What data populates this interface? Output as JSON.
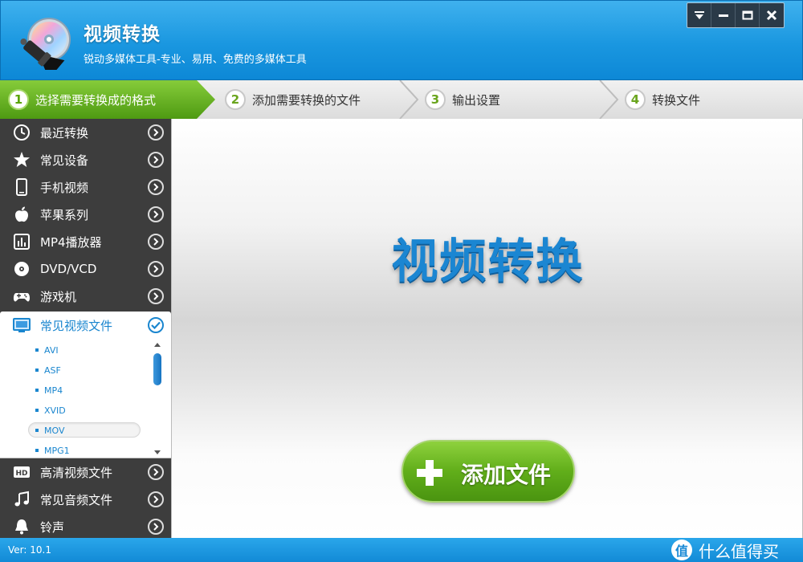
{
  "app": {
    "title": "视频转换",
    "subtitle": "锐动多媒体工具-专业、易用、免费的多媒体工具"
  },
  "window_controls": [
    "dropdown-icon",
    "minimize-icon",
    "maximize-icon",
    "close-icon"
  ],
  "steps": [
    {
      "num": "1",
      "label": "选择需要转换成的格式",
      "active": true
    },
    {
      "num": "2",
      "label": "添加需要转换的文件",
      "active": false
    },
    {
      "num": "3",
      "label": "输出设置",
      "active": false
    },
    {
      "num": "4",
      "label": "转换文件",
      "active": false
    }
  ],
  "sidebar": {
    "items": [
      {
        "label": "最近转换",
        "icon": "clock-icon"
      },
      {
        "label": "常见设备",
        "icon": "star-icon"
      },
      {
        "label": "手机视频",
        "icon": "phone-icon"
      },
      {
        "label": "苹果系列",
        "icon": "apple-icon"
      },
      {
        "label": "MP4播放器",
        "icon": "mp4-player-icon"
      },
      {
        "label": "DVD/VCD",
        "icon": "disc-icon"
      },
      {
        "label": "游戏机",
        "icon": "gamepad-icon"
      },
      {
        "label": "常见视频文件",
        "icon": "monitor-icon",
        "expanded": true
      },
      {
        "label": "高清视频文件",
        "icon": "hd-icon"
      },
      {
        "label": "常见音频文件",
        "icon": "music-icon"
      },
      {
        "label": "铃声",
        "icon": "bell-icon"
      }
    ],
    "formats": [
      "AVI",
      "ASF",
      "MP4",
      "XVID",
      "MOV",
      "MPG1"
    ],
    "selected_format": "MOV"
  },
  "main": {
    "title": "视频转换",
    "add_button_label": "添加文件"
  },
  "status": {
    "version": "Ver: 10.1",
    "watermark": "什么值得买",
    "watermark_icon": "值"
  },
  "colors": {
    "accent_blue": "#1a97e0",
    "step_active_green": "#5eb11c",
    "sidebar_bg": "#3d3d3d",
    "button_green": "#61ae1a"
  }
}
